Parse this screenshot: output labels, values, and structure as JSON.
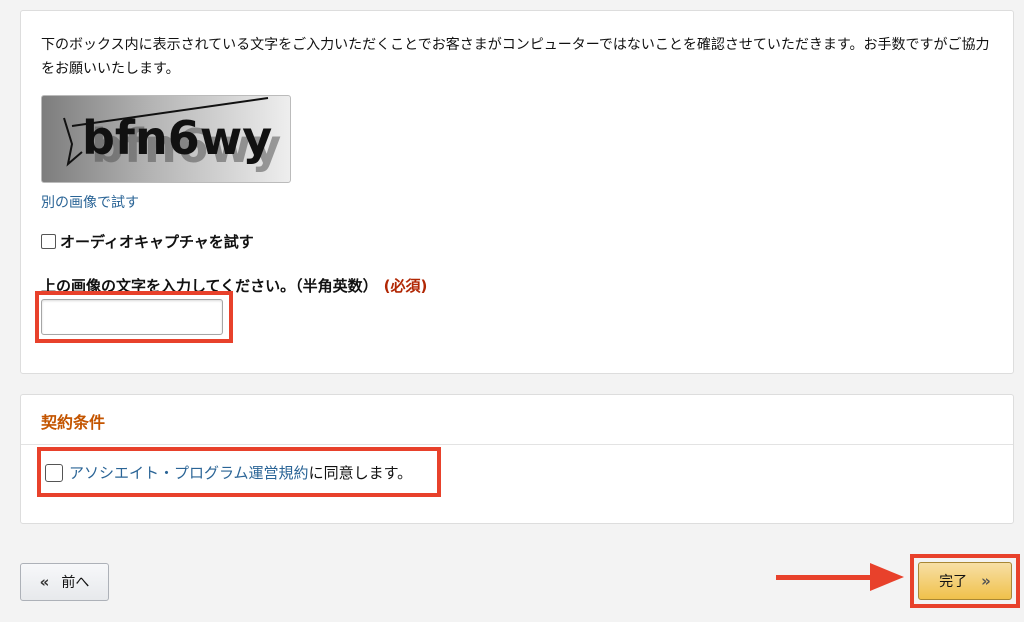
{
  "captcha": {
    "instructions": "下のボックス内に表示されている文字をご入力いただくことでお客さまがコンピューターではないことを確認させていただきます。お手数ですがご協力をお願いいたします。",
    "captcha_text": "bfn6wy",
    "retry_link": "別の画像で試す",
    "audio_option": "オーディオキャプチャを試す",
    "field_label": "上の画像の文字を入力してください。（半角英数）",
    "required_label": "(必須)",
    "input_value": ""
  },
  "terms": {
    "title": "契約条件",
    "agreement_link": "アソシエイト・プログラム運営規約",
    "agreement_suffix": "に同意します。"
  },
  "nav": {
    "back_label": "前へ",
    "back_icon": "«",
    "finish_label": "完了",
    "finish_icon": "»"
  },
  "colors": {
    "highlight": "#e8412b",
    "link": "#2a6496",
    "required": "#b12704",
    "section_title": "#c45500",
    "primary_button": "#f0c14b"
  }
}
